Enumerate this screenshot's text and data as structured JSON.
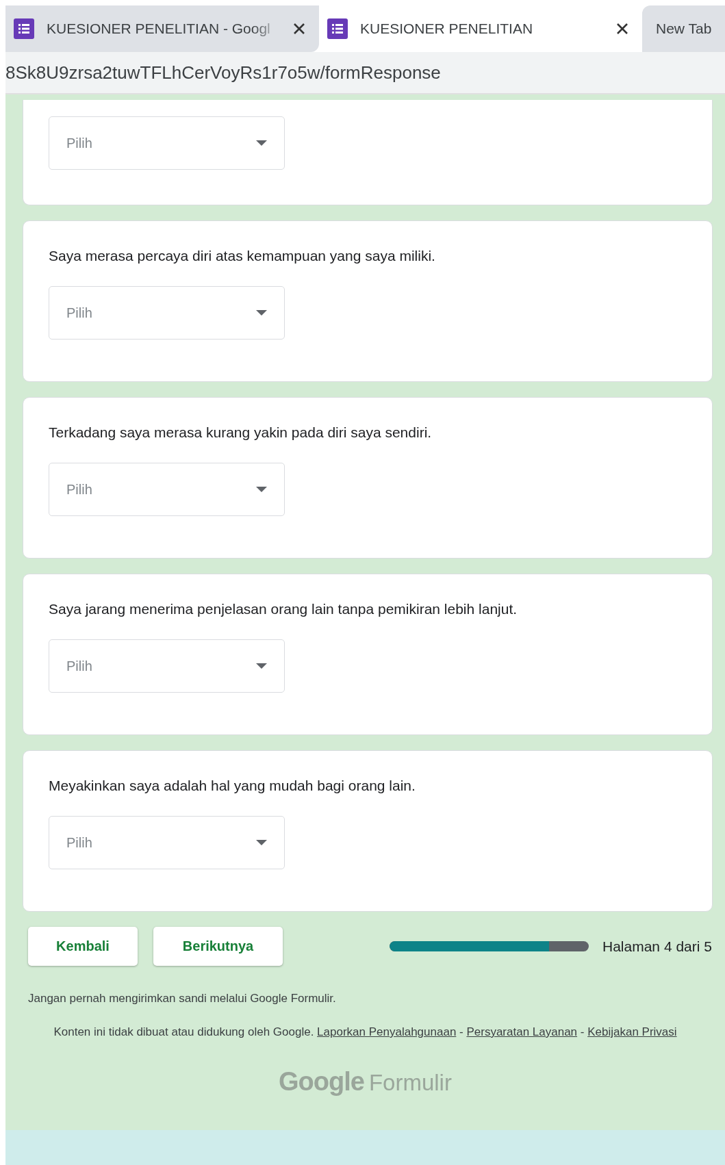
{
  "tabs": [
    {
      "kind": "form",
      "title": "KUESIONER PENELITIAN - Googl",
      "selected": false
    },
    {
      "kind": "form",
      "title": "KUESIONER PENELITIAN",
      "selected": true
    },
    {
      "kind": "plain",
      "title": "New Tab",
      "selected": false
    }
  ],
  "address": "8Sk8U9zrsa2tuwTFLhCerVoyRs1r7o5w/formResponse",
  "questions": [
    {
      "dropdown": {
        "placeholder": "Pilih"
      }
    },
    {
      "question": "Saya merasa percaya diri atas kemampuan yang saya miliki.",
      "dropdown": {
        "placeholder": "Pilih"
      }
    },
    {
      "question": "Terkadang saya merasa kurang yakin pada diri saya sendiri.",
      "dropdown": {
        "placeholder": "Pilih"
      }
    },
    {
      "question": "Saya jarang menerima penjelasan orang lain tanpa pemikiran lebih lanjut.",
      "dropdown": {
        "placeholder": "Pilih"
      }
    },
    {
      "question": "Meyakinkan saya adalah hal yang mudah bagi orang lain.",
      "dropdown": {
        "placeholder": "Pilih"
      }
    }
  ],
  "buttons": [
    "Kembali",
    "Berikutnya"
  ],
  "progress": {
    "level": 0.8,
    "label": "Halaman 4 dari 5"
  },
  "footer": {
    "warning": "Jangan pernah mengirimkan sandi melalui Google Formulir.",
    "disclaimer": "Konten ini tidak dibuat atau didukung oleh Google.",
    "links": [
      "Laporkan Penyalahgunaan",
      "Persyaratan Layanan",
      "Kebijakan Privasi"
    ],
    "separator": "-",
    "logo": {
      "brand": "Google",
      "product": "Formulir"
    }
  }
}
